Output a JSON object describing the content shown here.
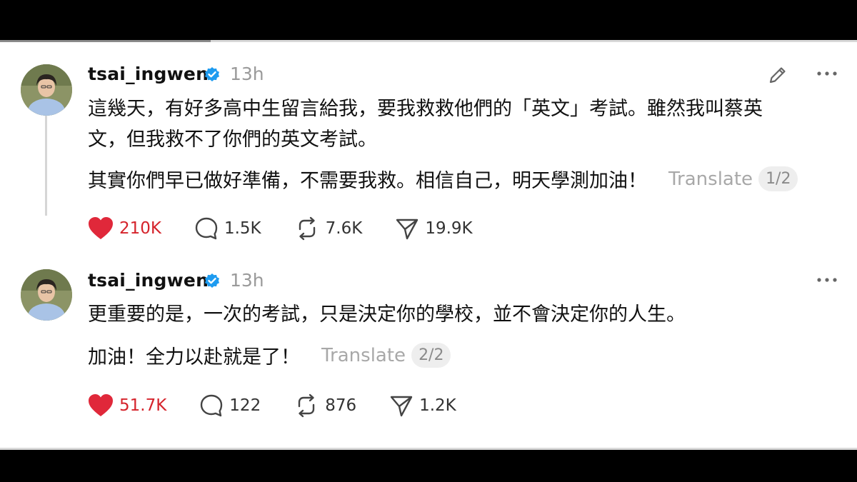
{
  "posts": [
    {
      "username": "tsai_ingwen",
      "time": "13h",
      "text_line1": "這幾天，有好多高中生留言給我，要我救救他們的「英文」考試。雖然我叫蔡英",
      "text_line2": "文，但我救不了你們的英文考試。",
      "text_line3": "其實你們早已做好準備，不需要我救。相信自己，明天學測加油！",
      "translate_label": "Translate",
      "page_badge": "1/2",
      "likes": "210K",
      "replies": "1.5K",
      "reposts": "7.6K",
      "shares": "19.9K"
    },
    {
      "username": "tsai_ingwen",
      "time": "13h",
      "text_line1": "更重要的是，一次的考試，只是決定你的學校，並不會決定你的人生。",
      "text_line2": "加油！全力以赴就是了！",
      "translate_label": "Translate",
      "page_badge": "2/2",
      "likes": "51.7K",
      "replies": "122",
      "reposts": "876",
      "shares": "1.2K"
    }
  ],
  "icons": {
    "verified": "verified-badge-icon",
    "edit": "pencil-icon",
    "more": "more-options-icon",
    "like": "heart-icon",
    "reply": "comment-icon",
    "repost": "repost-icon",
    "share": "send-icon"
  },
  "colors": {
    "like_active": "#e0283a",
    "verified_blue": "#1d9bf0",
    "muted_text": "#9a9a9a"
  }
}
